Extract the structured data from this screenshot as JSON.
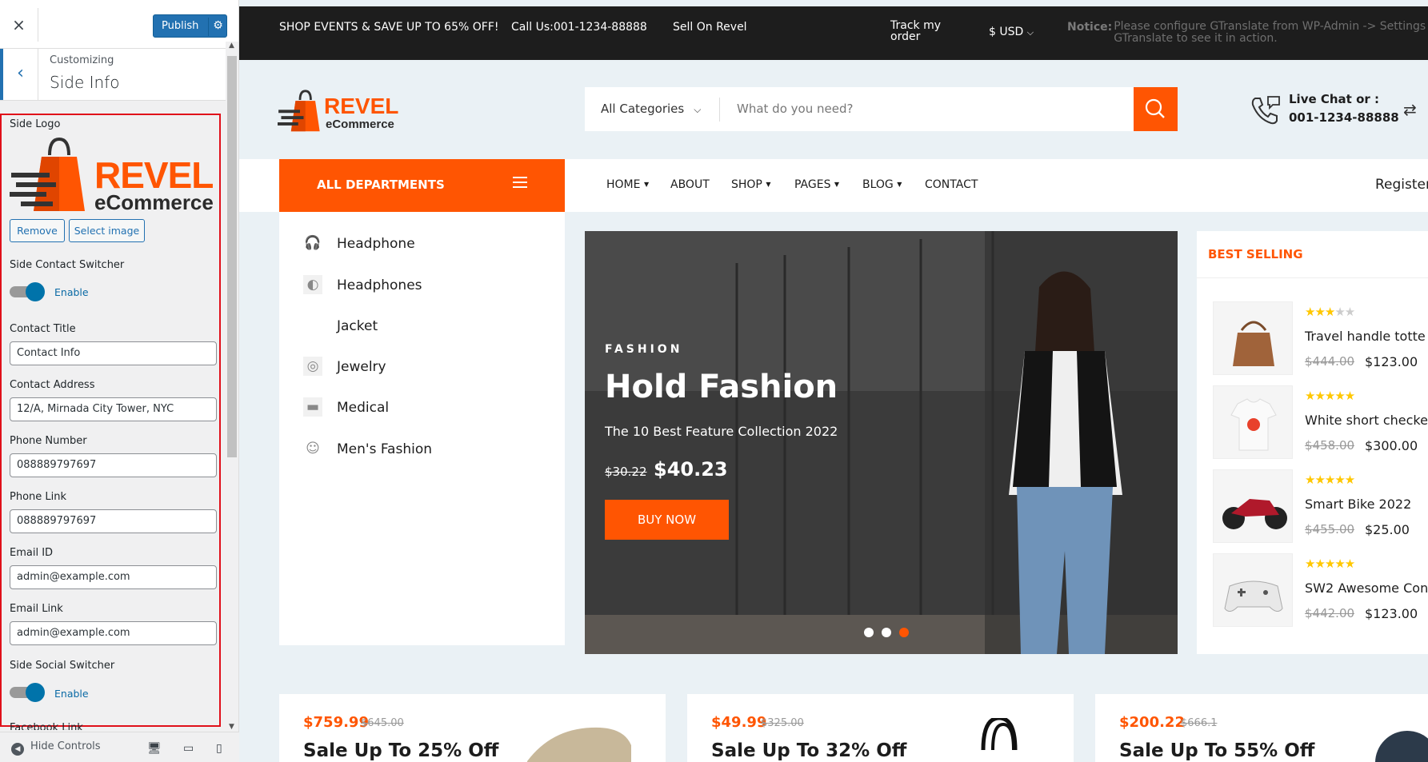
{
  "customizer": {
    "close_label": "×",
    "publish_label": "Publish",
    "breadcrumb": "Customizing",
    "section_title": "Side Info",
    "side_logo_label": "Side Logo",
    "logo_text_top": "REVEL",
    "logo_text_bottom": "eCommerce",
    "remove_label": "Remove",
    "select_image_label": "Select image",
    "contact_switcher_label": "Side Contact Switcher",
    "contact_switcher_state": "Enable",
    "fields": [
      {
        "label": "Contact Title",
        "value": "Contact Info"
      },
      {
        "label": "Contact Address",
        "value": "12/A, Mirnada City Tower, NYC"
      },
      {
        "label": "Phone Number",
        "value": "088889797697"
      },
      {
        "label": "Phone Link",
        "value": "088889797697"
      },
      {
        "label": "Email ID",
        "value": "admin@example.com"
      },
      {
        "label": "Email Link",
        "value": "admin@example.com"
      }
    ],
    "social_switcher_label": "Side Social Switcher",
    "social_switcher_state": "Enable",
    "next_label": "Facebook Link",
    "hide_controls_label": "Hide Controls"
  },
  "topbar": {
    "promo": "SHOP EVENTS & SAVE UP TO 65% OFF!",
    "call": "Call Us:001-1234-88888",
    "sell": "Sell On Revel",
    "track_1": "Track my",
    "track_2": "order",
    "currency": "$ USD",
    "notice_label": "Notice:",
    "notice_1": "Please configure GTranslate from WP-Admin -> Settings ->",
    "notice_2": "GTranslate to see it in action."
  },
  "header": {
    "logo_top": "REVEL",
    "logo_bottom": "eCommerce",
    "category": "All Categories",
    "search_placeholder": "What do you need?",
    "livechat_label": "Live Chat or :",
    "livechat_phone": "001-1234-88888"
  },
  "nav": {
    "all_departments": "ALL DEPARTMENTS",
    "items": [
      "HOME",
      "ABOUT",
      "SHOP",
      "PAGES",
      "BLOG",
      "CONTACT"
    ],
    "register": "Register"
  },
  "departments": [
    "Headphone",
    "Headphones",
    "Jacket",
    "Jewelry",
    "Medical",
    "Men's Fashion"
  ],
  "hero": {
    "kicker": "FASHION",
    "title": "Hold Fashion",
    "subtitle": "The 10 Best Feature Collection 2022",
    "old_price": "$30.22",
    "new_price": "$40.23",
    "button": "BUY NOW",
    "active_slide": 3,
    "slide_count": 3
  },
  "best_selling": {
    "title": "BEST SELLING",
    "items": [
      {
        "name": "Travel handle totte",
        "rating": 3,
        "old": "$444.00",
        "new": "$123.00"
      },
      {
        "name": "White short checke",
        "rating": 5,
        "old": "$458.00",
        "new": "$300.00"
      },
      {
        "name": "Smart Bike 2022",
        "rating": 5,
        "old": "$455.00",
        "new": "$25.00"
      },
      {
        "name": "SW2 Awesome Con",
        "rating": 5,
        "old": "$442.00",
        "new": "$123.00"
      }
    ]
  },
  "promos": [
    {
      "new": "$759.99",
      "old": "$645.00",
      "title": "Sale Up To 25% Off"
    },
    {
      "new": "$49.99",
      "old": "$325.00",
      "title": "Sale Up To 32% Off"
    },
    {
      "new": "$200.22",
      "old": "$666.1",
      "title": "Sale Up To 55% Off"
    }
  ],
  "colors": {
    "accent": "#ff5502",
    "wp_blue": "#2271b1",
    "highlight_border": "#e0101a"
  }
}
